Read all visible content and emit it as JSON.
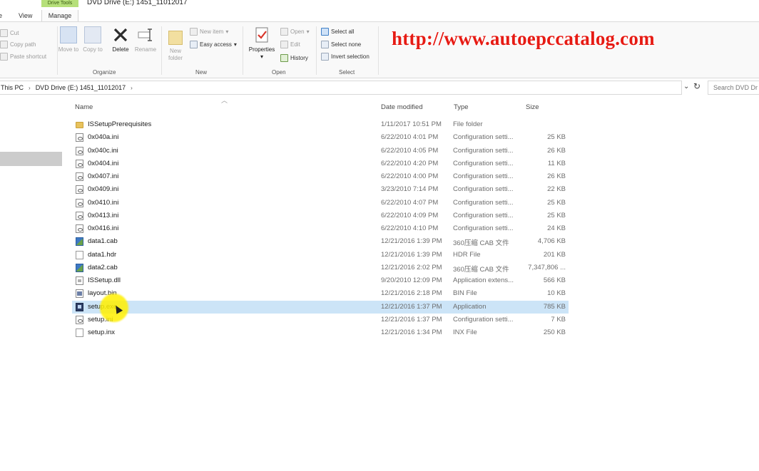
{
  "window": {
    "title": "DVD Drive (E:) 1451_11012017",
    "tabs": {
      "home": "e",
      "view": "View",
      "manage": "Manage"
    },
    "contextual_tab": "Drive Tools"
  },
  "ribbon": {
    "clipboard": {
      "cut": "Cut",
      "copy_path": "Copy path",
      "paste_shortcut": "Paste shortcut"
    },
    "organize": {
      "move_to": "Move to",
      "copy_to": "Copy to",
      "delete": "Delete",
      "rename": "Rename",
      "label": "Organize"
    },
    "new": {
      "new_folder": "New folder",
      "new_item": "New item",
      "easy_access": "Easy access",
      "label": "New"
    },
    "open": {
      "properties": "Properties",
      "open": "Open",
      "edit": "Edit",
      "history": "History",
      "label": "Open"
    },
    "select": {
      "select_all": "Select all",
      "select_none": "Select none",
      "invert_selection": "Invert selection",
      "label": "Select"
    }
  },
  "watermark": "http://www.autoepccatalog.com",
  "address": {
    "crumbs": [
      "This PC",
      "DVD Drive (E:) 1451_11012017"
    ],
    "search_placeholder": "Search DVD Dr"
  },
  "columns": {
    "name": "Name",
    "date": "Date modified",
    "type": "Type",
    "size": "Size"
  },
  "files": [
    {
      "name": "ISSetupPrerequisites",
      "date": "1/11/2017 10:51 PM",
      "type": "File folder",
      "size": "",
      "icon": "folder-icon"
    },
    {
      "name": "0x040a.ini",
      "date": "6/22/2010 4:01 PM",
      "type": "Configuration setti...",
      "size": "25 KB",
      "icon": "config-file-icon"
    },
    {
      "name": "0x040c.ini",
      "date": "6/22/2010 4:05 PM",
      "type": "Configuration setti...",
      "size": "26 KB",
      "icon": "config-file-icon"
    },
    {
      "name": "0x0404.ini",
      "date": "6/22/2010 4:20 PM",
      "type": "Configuration setti...",
      "size": "11 KB",
      "icon": "config-file-icon"
    },
    {
      "name": "0x0407.ini",
      "date": "6/22/2010 4:00 PM",
      "type": "Configuration setti...",
      "size": "26 KB",
      "icon": "config-file-icon"
    },
    {
      "name": "0x0409.ini",
      "date": "3/23/2010 7:14 PM",
      "type": "Configuration setti...",
      "size": "22 KB",
      "icon": "config-file-icon"
    },
    {
      "name": "0x0410.ini",
      "date": "6/22/2010 4:07 PM",
      "type": "Configuration setti...",
      "size": "25 KB",
      "icon": "config-file-icon"
    },
    {
      "name": "0x0413.ini",
      "date": "6/22/2010 4:09 PM",
      "type": "Configuration setti...",
      "size": "25 KB",
      "icon": "config-file-icon"
    },
    {
      "name": "0x0416.ini",
      "date": "6/22/2010 4:10 PM",
      "type": "Configuration setti...",
      "size": "24 KB",
      "icon": "config-file-icon"
    },
    {
      "name": "data1.cab",
      "date": "12/21/2016 1:39 PM",
      "type": "360压缩 CAB 文件",
      "size": "4,706 KB",
      "icon": "cab-archive-icon"
    },
    {
      "name": "data1.hdr",
      "date": "12/21/2016 1:39 PM",
      "type": "HDR File",
      "size": "201 KB",
      "icon": "blank-file-icon"
    },
    {
      "name": "data2.cab",
      "date": "12/21/2016 2:02 PM",
      "type": "360压缩 CAB 文件",
      "size": "7,347,806 ...",
      "icon": "cab-archive-icon"
    },
    {
      "name": "ISSetup.dll",
      "date": "9/20/2010 12:09 PM",
      "type": "Application extens...",
      "size": "566 KB",
      "icon": "dll-file-icon"
    },
    {
      "name": "layout.bin",
      "date": "12/21/2016 2:18 PM",
      "type": "BIN File",
      "size": "10 KB",
      "icon": "bin-file-icon"
    },
    {
      "name": "setup.exe",
      "date": "12/21/2016 1:37 PM",
      "type": "Application",
      "size": "785 KB",
      "icon": "setup-exe-icon",
      "selected": true
    },
    {
      "name": "setup.ini",
      "date": "12/21/2016 1:37 PM",
      "type": "Configuration setti...",
      "size": "7 KB",
      "icon": "config-file-icon"
    },
    {
      "name": "setup.inx",
      "date": "12/21/2016 1:34 PM",
      "type": "INX File",
      "size": "250 KB",
      "icon": "blank-file-icon"
    }
  ],
  "colors": {
    "selection": "#cce4f7",
    "watermark": "#e61b14",
    "drive_tools_tab": "#b6e07a",
    "cursor_highlight": "#fff000"
  }
}
